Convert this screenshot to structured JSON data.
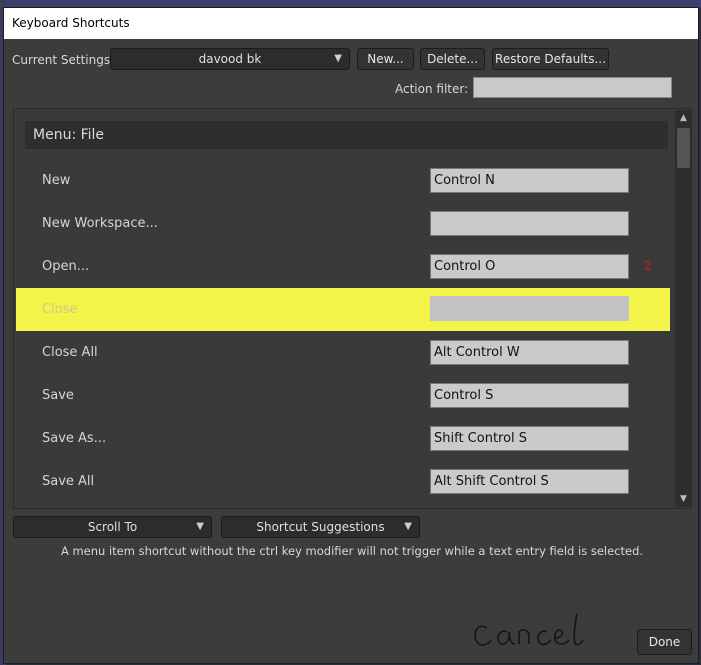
{
  "window": {
    "title": "Keyboard Shortcuts"
  },
  "toolbar": {
    "current_settings_label": "Current Settings",
    "preset_value": "davood bk",
    "new_label": "New...",
    "delete_label": "Delete...",
    "restore_label": "Restore Defaults..."
  },
  "filter": {
    "label": "Action filter:",
    "value": ""
  },
  "section": {
    "title": "Menu: File"
  },
  "rows": [
    {
      "label": "New",
      "shortcut": "Control N"
    },
    {
      "label": "New Workspace...",
      "shortcut": ""
    },
    {
      "label": "Open...",
      "shortcut": "Control O",
      "badge": "2"
    },
    {
      "label": "Close",
      "shortcut": ""
    },
    {
      "label": "Close All",
      "shortcut": "Alt Control W"
    },
    {
      "label": "Save",
      "shortcut": "Control S"
    },
    {
      "label": "Save As...",
      "shortcut": "Shift Control S"
    },
    {
      "label": "Save All",
      "shortcut": "Alt Shift Control S"
    }
  ],
  "bottom": {
    "scroll_to_label": "Scroll To",
    "suggestions_label": "Shortcut Suggestions",
    "note": "A menu item shortcut without the ctrl key modifier will not trigger while a text entry field is selected.",
    "done_label": "Done"
  },
  "colors": {
    "highlight": "#f2f44a",
    "badge": "#c62020"
  }
}
